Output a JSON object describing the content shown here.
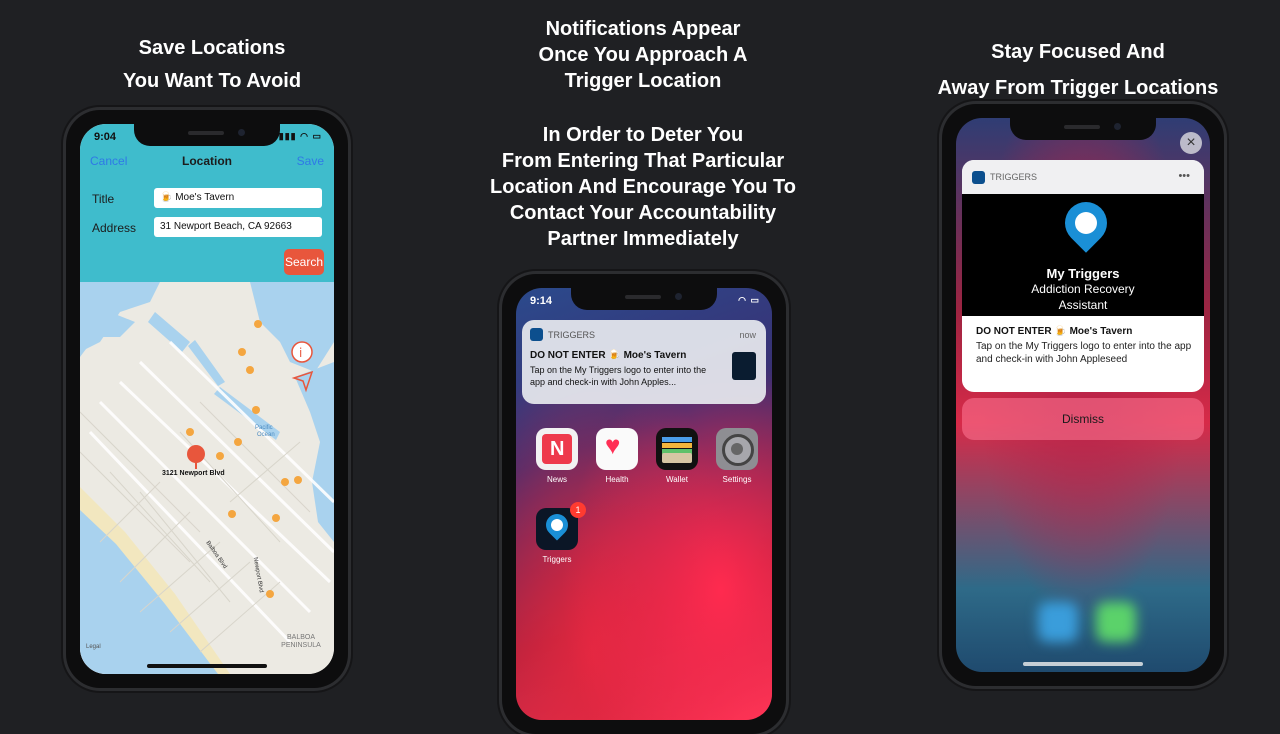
{
  "captions": {
    "left": [
      "Save Locations",
      "You Want To Avoid"
    ],
    "middle_top": [
      "Notifications Appear",
      "Once You Approach A",
      "Trigger Location"
    ],
    "middle_bottom": [
      "In Order to Deter You",
      "From Entering That Particular",
      "Location And Encourage You To",
      "Contact Your Accountability",
      "Partner Immediately"
    ],
    "right": [
      "Stay Focused And",
      "Away From Trigger Locations"
    ]
  },
  "phone1": {
    "time": "9:04",
    "nav": {
      "cancel": "Cancel",
      "title": "Location",
      "save": "Save"
    },
    "title_label": "Title",
    "title_value": "🍺 Moe's Tavern",
    "address_label": "Address",
    "address_value": "31  Newport Beach, CA 92663",
    "search_button": "Search",
    "map_pin_label": "3121 Newport Blvd",
    "map_labels": [
      "Pacific Ocean",
      "BALBOA PENINSULA",
      "Newport Blvd",
      "Balboa Blvd",
      "Pacific",
      "Ocean",
      "Legal"
    ]
  },
  "phone2": {
    "time": "9:14",
    "notification": {
      "app": "TRIGGERS",
      "when": "now",
      "title": "DO NOT ENTER 🍺 Moe's Tavern",
      "body": "Tap on the My Triggers logo to enter into the app and check-in with John Apples..."
    },
    "apps": [
      {
        "label": "News"
      },
      {
        "label": "Health"
      },
      {
        "label": "Wallet"
      },
      {
        "label": "Settings"
      },
      {
        "label": "Triggers",
        "badge": "1"
      }
    ]
  },
  "phone3": {
    "notification": {
      "app": "TRIGGERS",
      "menu": "•••",
      "brand_title": "My Triggers",
      "brand_sub1": "Addiction Recovery",
      "brand_sub2": "Assistant",
      "title": "DO NOT ENTER 🍺 Moe's Tavern",
      "body": "Tap on the My Triggers logo to enter into the app and check-in with John Appleseed"
    },
    "dismiss": "Dismiss",
    "close": "×"
  },
  "colors": {
    "background": "#1f2023",
    "teal": "#3fbccc",
    "search": "#e8563c",
    "brand_blue": "#1a8fd6"
  }
}
